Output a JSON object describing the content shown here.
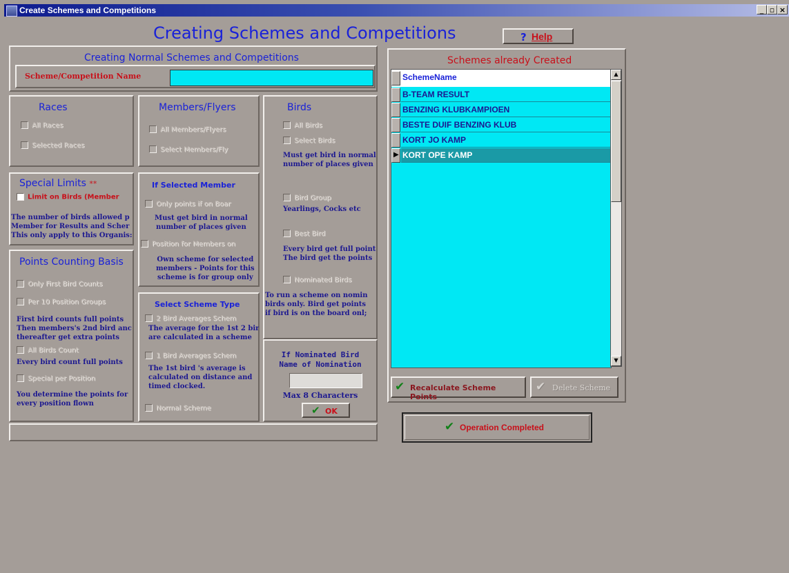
{
  "window": {
    "title": "Create Schemes and Competitions"
  },
  "header": {
    "title": "Creating Schemes and Competitions",
    "help_label": "Help",
    "help_prefix": "?"
  },
  "normal": {
    "title": "Creating Normal Schemes and Competitions",
    "name_label": "Scheme/Competition Name",
    "name_value": ""
  },
  "races": {
    "title": "Races",
    "all": "All Races",
    "selected": "Selected Races"
  },
  "members": {
    "title": "Members/Flyers",
    "all": "All Members/Flyers",
    "select": "Select Members/Fly"
  },
  "birds": {
    "title": "Birds",
    "all": "All Birds",
    "select": "Select Birds",
    "desc1": "Must get bird in normal\nnumber of places given",
    "group": "Bird Group",
    "group_desc": "Yearlings, Cocks etc",
    "best": "Best Bird",
    "best_desc": "Every bird get full point\nThe bird get the points",
    "nominated": "Nominated Birds",
    "nominated_desc": "To run a scheme on nomin\nbirds only. Bird get points\nif bird is on the board onl;"
  },
  "special": {
    "title": "Special Limits",
    "stars": "**",
    "limit": "Limit on Birds (Member",
    "desc": "The number of birds allowed p\nMember for Results and Scher\nThis only apply to this Organis:"
  },
  "selected_member": {
    "title": "If Selected Member",
    "only_points": "Only points if on Boar",
    "desc1": "Must get bird in normal\nnumber of places given",
    "position": "Position for Members on",
    "desc2": "Own scheme for selected\nmembers - Points for this\nscheme is for group only"
  },
  "points": {
    "title": "Points Counting Basis",
    "first": "Only First Bird Counts",
    "per10": "Per 10 Position Groups",
    "desc1": "First bird counts full points\nThen members's 2nd bird anc\nthereafter get extra points",
    "all": "All Birds Count",
    "desc2": "Every bird count full points",
    "special": "Special per Position",
    "desc3": "You determine the points for\nevery position flown"
  },
  "scheme_type": {
    "title": "Select Scheme Type",
    "two": "2 Bird Averages Schem",
    "two_desc": "The average for the 1st 2 bir\nare calculated in a scheme",
    "one": "1 Bird Averages Schem",
    "one_desc": "The 1st bird 's average is\ncalculated on distance and\ntimed clocked.",
    "normal": "Normal Scheme"
  },
  "nomination": {
    "title1": "If Nominated Bird",
    "title2": "Name of Nomination",
    "value": "",
    "max": "Max 8 Characters",
    "ok": "OK"
  },
  "schemes": {
    "title": "Schemes already Created",
    "column": "SchemeName",
    "rows": [
      "B-TEAM RESULT",
      "BENZING KLUBKAMPIOEN",
      "BESTE DUIF BENZING KLUB",
      "KORT JO KAMP",
      "KORT OPE KAMP"
    ],
    "selected_index": 4,
    "recalc": "Recalculate Scheme Points",
    "delete": "Delete Scheme"
  },
  "status": {
    "text": "Operation Completed"
  },
  "colors": {
    "cyan": "#00e8f4",
    "blue": "#1a22d8",
    "red": "#c8101a",
    "navy": "#1c1890"
  }
}
